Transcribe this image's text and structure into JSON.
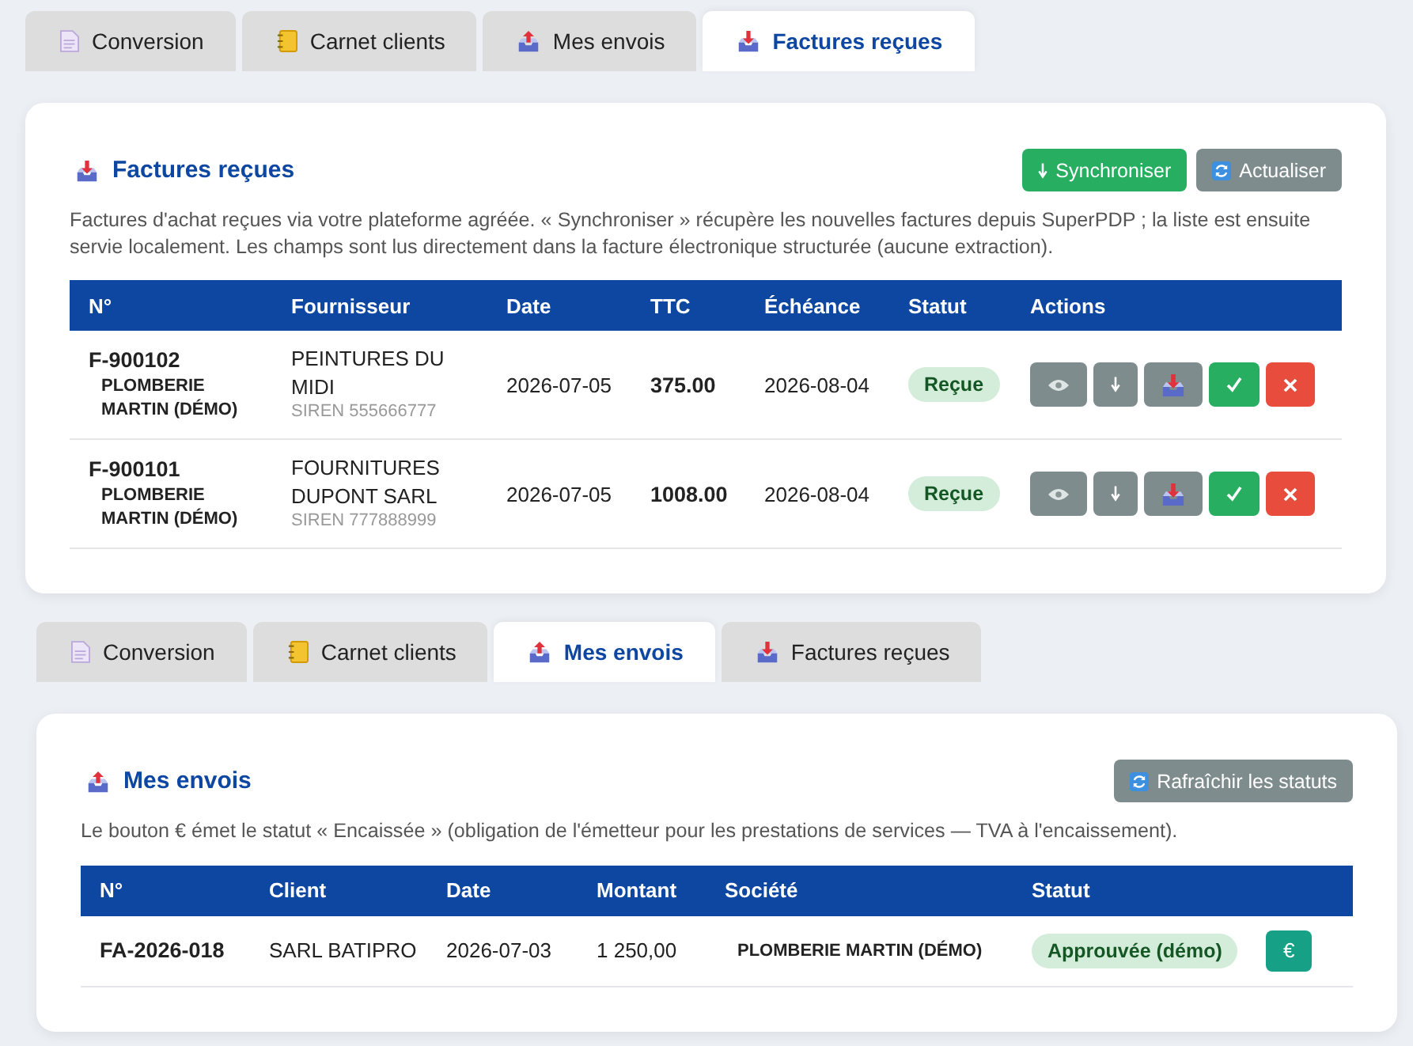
{
  "sections": [
    {
      "tabs": [
        {
          "label": "Conversion",
          "selected": false
        },
        {
          "label": "Carnet clients",
          "selected": false
        },
        {
          "label": "Mes envois",
          "selected": false
        },
        {
          "label": "Factures reçues",
          "selected": true
        }
      ],
      "panel": {
        "title": "Factures reçues",
        "buttons": [
          {
            "kind": "sync",
            "label": "Synchroniser"
          },
          {
            "kind": "refresh",
            "label": "Actualiser"
          }
        ],
        "description": "Factures d'achat reçues via votre plateforme agréée. « Synchroniser » récupère les nouvelles factures depuis SuperPDP ; la liste est ensuite servie localement. Les champs sont lus directement dans la facture électronique structurée (aucune extraction).",
        "table": {
          "kind": "received",
          "columns": [
            "N°",
            "Fournisseur",
            "Date",
            "TTC",
            "Échéance",
            "Statut",
            "Actions"
          ],
          "rows": [
            {
              "cells": [
                {
                  "kind": "ref",
                  "text": "F-900102",
                  "sub": "PLOMBERIE MARTIN (DÉMO)"
                },
                {
                  "kind": "party",
                  "text": "PEINTURES DU MIDI",
                  "sub": "SIREN 555666777"
                },
                {
                  "kind": "text",
                  "text": "2026-07-05"
                },
                {
                  "kind": "amount",
                  "text": "375.00"
                },
                {
                  "kind": "text",
                  "text": "2026-08-04"
                },
                {
                  "kind": "status",
                  "text": "Reçue"
                },
                {
                  "kind": "actions",
                  "actions": [
                    {
                      "kind": "view"
                    },
                    {
                      "kind": "download"
                    },
                    {
                      "kind": "import"
                    },
                    {
                      "kind": "approve"
                    },
                    {
                      "kind": "reject"
                    }
                  ]
                }
              ]
            },
            {
              "cells": [
                {
                  "kind": "ref",
                  "text": "F-900101",
                  "sub": "PLOMBERIE MARTIN (DÉMO)"
                },
                {
                  "kind": "party",
                  "text": "FOURNITURES DUPONT SARL",
                  "sub": "SIREN 777888999"
                },
                {
                  "kind": "text",
                  "text": "2026-07-05"
                },
                {
                  "kind": "amount",
                  "text": "1008.00"
                },
                {
                  "kind": "text",
                  "text": "2026-08-04"
                },
                {
                  "kind": "status",
                  "text": "Reçue"
                },
                {
                  "kind": "actions",
                  "actions": [
                    {
                      "kind": "view"
                    },
                    {
                      "kind": "download"
                    },
                    {
                      "kind": "import"
                    },
                    {
                      "kind": "approve"
                    },
                    {
                      "kind": "reject"
                    }
                  ]
                }
              ]
            }
          ]
        }
      }
    },
    {
      "tabs": [
        {
          "label": "Conversion",
          "selected": false
        },
        {
          "label": "Carnet clients",
          "selected": false
        },
        {
          "label": "Mes envois",
          "selected": true
        },
        {
          "label": "Factures reçues",
          "selected": false
        }
      ],
      "panel": {
        "title": "Mes envois",
        "buttons": [
          {
            "kind": "refresh",
            "label": "Rafraîchir les statuts"
          }
        ],
        "description": "Le bouton € émet le statut « Encaissée » (obligation de l'émetteur pour les prestations de services — TVA à l'encaissement).",
        "table": {
          "kind": "sent",
          "columns": [
            "N°",
            "Client",
            "Date",
            "Montant",
            "Société",
            "Statut"
          ],
          "rows": [
            {
              "cells": [
                {
                  "kind": "ref",
                  "text": "FA-2026-018"
                },
                {
                  "kind": "text",
                  "text": "SARL BATIPRO"
                },
                {
                  "kind": "text",
                  "text": "2026-07-03"
                },
                {
                  "kind": "text",
                  "text": "1 250,00"
                },
                {
                  "kind": "company",
                  "text": "PLOMBERIE MARTIN (DÉMO)"
                },
                {
                  "kind": "status",
                  "text": "Approuvée (démo)"
                },
                {
                  "kind": "actions",
                  "actions": [
                    {
                      "kind": "cash",
                      "label": "€"
                    }
                  ]
                }
              ]
            }
          ]
        }
      }
    }
  ]
}
